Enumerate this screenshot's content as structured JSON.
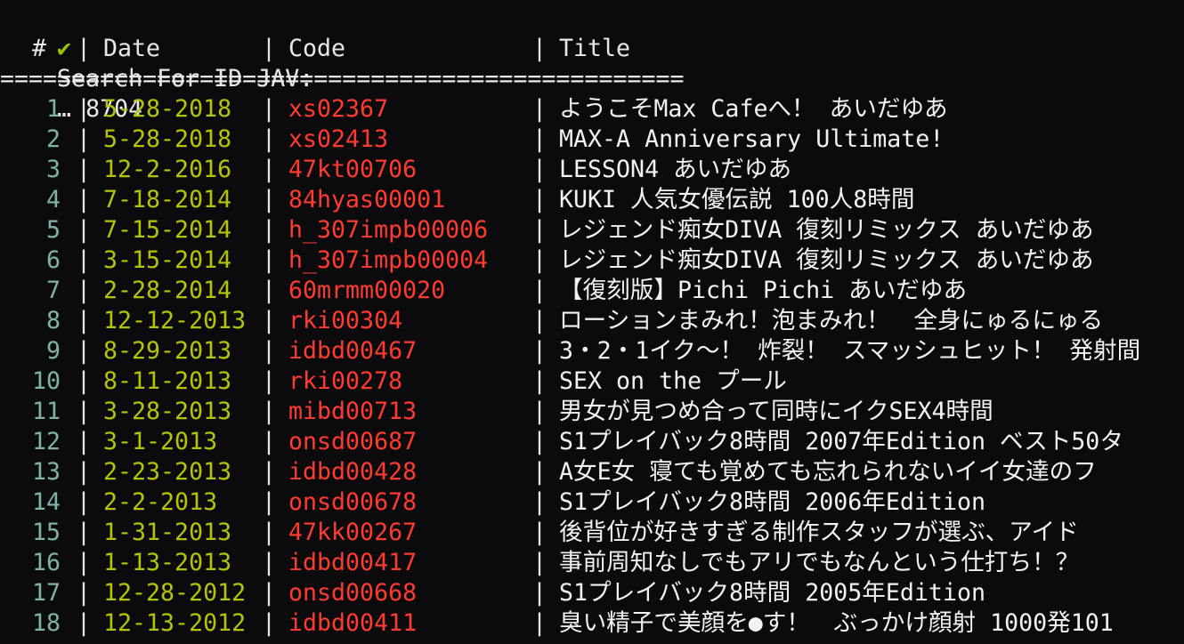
{
  "prompt": {
    "check": "✔",
    "label": "Search For ID JAV:",
    "value": "… 8704"
  },
  "table": {
    "headers": {
      "num": "#",
      "date": "Date",
      "code": "Code",
      "title": "Title"
    },
    "separator": "|",
    "rule": "================================================",
    "rows": [
      {
        "num": "1",
        "date": "5-28-2018",
        "code": "xs02367",
        "title": "ようこそMax Cafeへ！ あいだゆあ"
      },
      {
        "num": "2",
        "date": "5-28-2018",
        "code": "xs02413",
        "title": "MAX-A Anniversary Ultimate!"
      },
      {
        "num": "3",
        "date": "12-2-2016",
        "code": "47kt00706",
        "title": "LESSON4 あいだゆあ"
      },
      {
        "num": "4",
        "date": "7-18-2014",
        "code": "84hyas00001",
        "title": "KUKI 人気女優伝説 100人8時間"
      },
      {
        "num": "5",
        "date": "7-15-2014",
        "code": "h_307impb00006",
        "title": "レジェンド痴女DIVA 復刻リミックス あいだゆあ"
      },
      {
        "num": "6",
        "date": "3-15-2014",
        "code": "h_307impb00004",
        "title": "レジェンド痴女DIVA 復刻リミックス あいだゆあ"
      },
      {
        "num": "7",
        "date": "2-28-2014",
        "code": "60mrmm00020",
        "title": "【復刻版】Pichi Pichi あいだゆあ"
      },
      {
        "num": "8",
        "date": "12-12-2013",
        "code": "rki00304",
        "title": "ローションまみれ！泡まみれ！　全身にゅるにゅる"
      },
      {
        "num": "9",
        "date": "8-29-2013",
        "code": "idbd00467",
        "title": "3・2・1イク～！ 炸裂！ スマッシュヒット！ 発射間"
      },
      {
        "num": "10",
        "date": "8-11-2013",
        "code": "rki00278",
        "title": "SEX on the プール"
      },
      {
        "num": "11",
        "date": "3-28-2013",
        "code": "mibd00713",
        "title": "男女が見つめ合って同時にイクSEX4時間"
      },
      {
        "num": "12",
        "date": "3-1-2013",
        "code": "onsd00687",
        "title": "S1プレイバック8時間 2007年Edition ベスト50タ"
      },
      {
        "num": "13",
        "date": "2-23-2013",
        "code": "idbd00428",
        "title": "A女E女 寝ても覚めても忘れられないイイ女達のフ"
      },
      {
        "num": "14",
        "date": "2-2-2013",
        "code": "onsd00678",
        "title": "S1プレイバック8時間 2006年Edition"
      },
      {
        "num": "15",
        "date": "1-31-2013",
        "code": "47kk00267",
        "title": "後背位が好きすぎる制作スタッフが選ぶ、アイド"
      },
      {
        "num": "16",
        "date": "1-13-2013",
        "code": "idbd00417",
        "title": "事前周知なしでもアリでもなんという仕打ち！？"
      },
      {
        "num": "17",
        "date": "12-28-2012",
        "code": "onsd00668",
        "title": "S1プレイバック8時間 2005年Edition"
      },
      {
        "num": "18",
        "date": "12-13-2012",
        "code": "idbd00411",
        "title": "臭い精子で美顔を●す！　ぶっかけ顔射 1000発101"
      }
    ]
  }
}
